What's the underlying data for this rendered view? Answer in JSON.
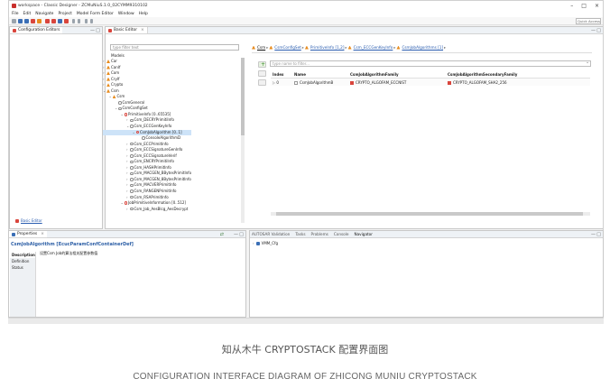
{
  "window": {
    "title": "workspace - Classic Designer - ZCMuNiuS.1.0_02CYMM9310102",
    "controls": [
      "–",
      "□",
      "×"
    ]
  },
  "menu": [
    "File",
    "Edit",
    "Navigate",
    "Project",
    "Model Form Editor",
    "Window",
    "Help"
  ],
  "quick_access": "Quick Access",
  "config_editors": {
    "tab": "Configuration Editors",
    "link": "Basic Editor"
  },
  "basic_editor": {
    "tab": "Basic Editor",
    "filter_placeholder": "type filter text",
    "models_label": "Models",
    "tree": [
      {
        "label": "Car",
        "depth": 0,
        "twisty": "›",
        "icon": "car"
      },
      {
        "label": "CanIf",
        "depth": 0,
        "twisty": "›",
        "icon": "car"
      },
      {
        "label": "Com",
        "depth": 0,
        "twisty": "›",
        "icon": "car"
      },
      {
        "label": "CryIf",
        "depth": 0,
        "twisty": "›",
        "icon": "car"
      },
      {
        "label": "Crypto",
        "depth": 0,
        "twisty": "›",
        "icon": "car"
      },
      {
        "label": "Csm",
        "depth": 0,
        "twisty": "⌄",
        "icon": "car"
      },
      {
        "label": "Csm",
        "depth": 1,
        "twisty": "⌄",
        "icon": "car"
      },
      {
        "label": "CsmGeneral",
        "depth": 2,
        "twisty": "",
        "icon": "leaf"
      },
      {
        "label": "CsmConfigSet",
        "depth": 2,
        "twisty": "⌄",
        "icon": "leaf"
      },
      {
        "label": "Primitivelnfo [0..65535]",
        "depth": 3,
        "twisty": "⌄",
        "icon": "redleaf"
      },
      {
        "label": "Csm_DECRYPrimitiInfo",
        "depth": 4,
        "twisty": "›",
        "icon": "leaf"
      },
      {
        "label": "Csm_ECCGenKeyInfo",
        "depth": 4,
        "twisty": "⌄",
        "icon": "leaf"
      },
      {
        "label": "CsmJobAlgorithm [0..1]",
        "depth": 5,
        "twisty": "⌄",
        "icon": "redleaf",
        "selected": true
      },
      {
        "label": "ConsoleAlgorithmD",
        "depth": 6,
        "twisty": "",
        "icon": "leaf"
      },
      {
        "label": "Csm_ECCPrimitInfo",
        "depth": 4,
        "twisty": "›",
        "icon": "leaf"
      },
      {
        "label": "Csm_ECCSignatureGenInfo",
        "depth": 4,
        "twisty": "›",
        "icon": "leaf"
      },
      {
        "label": "Csm_ECCSignatureVerif",
        "depth": 4,
        "twisty": "›",
        "icon": "leaf"
      },
      {
        "label": "Csm_ENCRYPrimitiInfo",
        "depth": 4,
        "twisty": "›",
        "icon": "leaf"
      },
      {
        "label": "Csm_HASHPrimitInfo",
        "depth": 4,
        "twisty": "›",
        "icon": "leaf"
      },
      {
        "label": "Csm_MACGEN_BBytesPrimitInfo",
        "depth": 4,
        "twisty": "›",
        "icon": "leaf"
      },
      {
        "label": "Csm_MACGEN_8BytesPrimitInfo",
        "depth": 4,
        "twisty": "›",
        "icon": "leaf"
      },
      {
        "label": "Csm_MACVERPrimitInfo",
        "depth": 4,
        "twisty": "›",
        "icon": "leaf"
      },
      {
        "label": "Csm_RANGENPrimitInfo",
        "depth": 4,
        "twisty": "›",
        "icon": "leaf"
      },
      {
        "label": "Csm_RSAPrimitInfo",
        "depth": 4,
        "twisty": "›",
        "icon": "leaf"
      },
      {
        "label": "JobPrimitivelnformation [0..512]",
        "depth": 3,
        "twisty": "⌄",
        "icon": "redleaf"
      },
      {
        "label": "Csm_Job_AesBlcg_AesDecrypt",
        "depth": 4,
        "twisty": "›",
        "icon": "leaf"
      }
    ]
  },
  "breadcrumb": [
    "Csm",
    "CsmConfigSet",
    "Primitivelnfo [1,2]",
    "Csm_ECCGenKeyInfo",
    "CsmJobAlgorithms [1]"
  ],
  "table": {
    "filter_placeholder": "type name to filter...",
    "headers": [
      "Index",
      "Name",
      "CsmJobAlgorithmFamily",
      "CsmJobAlgorithmSecondaryFamily"
    ],
    "rows": [
      {
        "index": "0",
        "name": "CsmJobAlgorithmB",
        "family": "CRYPTO_ALGOFAM_ECCNIST",
        "secondary": "CRYPTO_ALGOFAM_SHA2_256"
      }
    ]
  },
  "properties": {
    "tab": "Properties",
    "heading": "CsmJobAlgorithm [EcucParamConfContainerDef]",
    "side_tabs": [
      "Description",
      "Definition",
      "Status"
    ],
    "description": "设置Csm Job的算法相关配置参数值"
  },
  "bottom_tabs": [
    "AUTOSAR Validation",
    "Tasks",
    "Problems",
    "Console",
    "Navigator"
  ],
  "navigator_item": "VMM_Cfg",
  "captions": {
    "chinese": "知从木牛 CRYPTOSTACK 配置界面图",
    "english": "CONFIGURATION INTERFACE DIAGRAM OF ZHICONG MUNIU CRYPTOSTACK"
  }
}
